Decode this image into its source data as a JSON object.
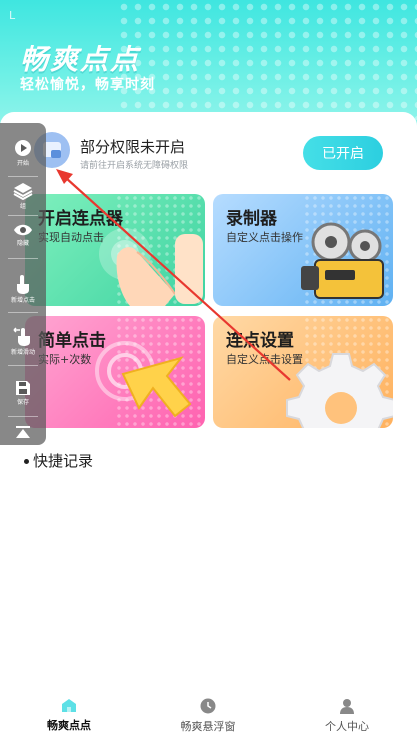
{
  "status": {
    "indicator": "L"
  },
  "header": {
    "title": "畅爽点点",
    "subtitle": "轻松愉悦，畅享时刻"
  },
  "permission": {
    "title": "部分权限未开启",
    "desc": "请前往开启系统无障碍权限",
    "button_label": "已开启"
  },
  "cards": [
    {
      "title": "开启连点器",
      "desc": "实现自动点击"
    },
    {
      "title": "录制器",
      "desc": "自定义点击操作"
    },
    {
      "title": "简单点击",
      "desc": "实际+次数"
    },
    {
      "title": "连点设置",
      "desc": "自定义点击设置"
    }
  ],
  "quick_records": "快捷记录",
  "floatbar": {
    "items": [
      {
        "label": "开始",
        "icon": "play-icon"
      },
      {
        "label": "组",
        "icon": "layers-icon"
      },
      {
        "label": "隐藏",
        "icon": "eye-icon"
      },
      {
        "label": "新增点击",
        "icon": "tap-add-icon"
      },
      {
        "label": "新增滑动",
        "icon": "swipe-add-icon"
      },
      {
        "label": "保存",
        "icon": "save-icon"
      },
      {
        "label": "",
        "icon": "collapse-icon"
      }
    ]
  },
  "nav": {
    "items": [
      {
        "label": "畅爽点点",
        "icon": "home-icon",
        "active": true
      },
      {
        "label": "畅爽悬浮窗",
        "icon": "clock-icon",
        "active": false
      },
      {
        "label": "个人中心",
        "icon": "person-icon",
        "active": false
      }
    ]
  },
  "colors": {
    "brand": "#3fe6e0",
    "button": "#2ccfe0",
    "annotation_arrow": "#e8382f",
    "card_green": "#3ed3a2",
    "card_blue": "#5fb1f2",
    "card_pink": "#ff62b0",
    "card_orange": "#ffb15d"
  }
}
